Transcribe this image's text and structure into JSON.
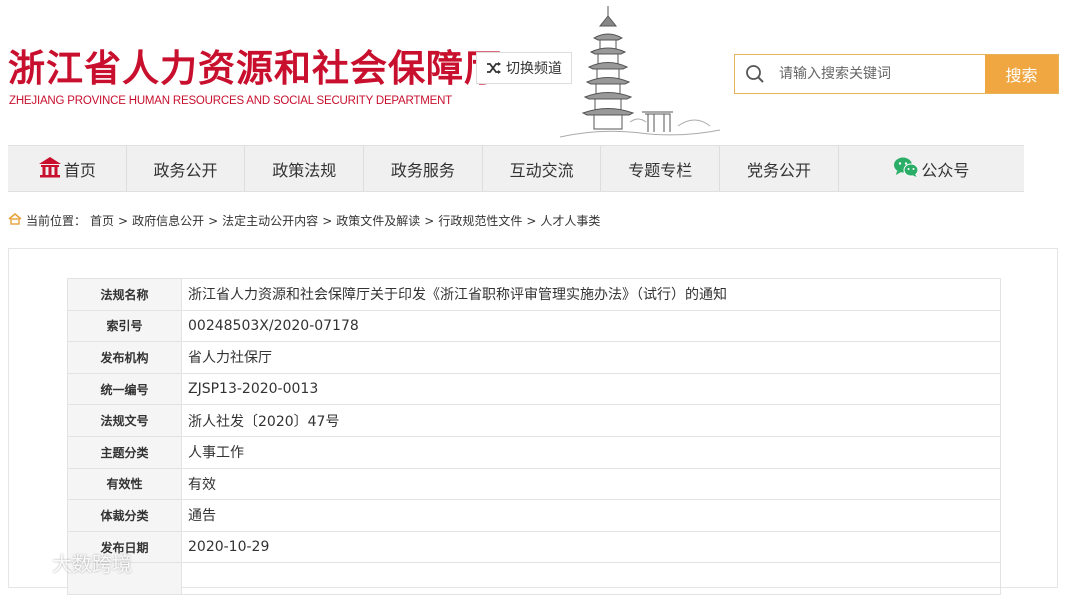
{
  "header": {
    "title": "浙江省人力资源和社会保障厅",
    "subtitle": "ZHEJIANG PROVINCE HUMAN RESOURCES AND SOCIAL SECURITY DEPARTMENT",
    "switch_channel": "切换频道",
    "brand_color": "#c8102e"
  },
  "search": {
    "placeholder": "请输入搜索关键词",
    "button": "搜索",
    "accent_color": "#f0a742"
  },
  "nav": {
    "items": [
      {
        "label": "首页",
        "icon": "home-icon"
      },
      {
        "label": "政务公开"
      },
      {
        "label": "政策法规"
      },
      {
        "label": "政务服务"
      },
      {
        "label": "互动交流"
      },
      {
        "label": "专题专栏"
      },
      {
        "label": "党务公开"
      },
      {
        "label": "公众号",
        "icon": "wechat-icon"
      }
    ]
  },
  "breadcrumb": {
    "prefix": "当前位置：",
    "items": [
      "首页",
      "政府信息公开",
      "法定主动公开内容",
      "政策文件及解读",
      "行政规范性文件",
      "人才人事类"
    ],
    "separator": ">"
  },
  "info": {
    "rows": [
      {
        "label": "法规名称",
        "value": "浙江省人力资源和社会保障厅关于印发《浙江省职称评审管理实施办法》（试行）的通知"
      },
      {
        "label": "索引号",
        "value": "00248503X/2020-07178"
      },
      {
        "label": "发布机构",
        "value": "省人力社保厅"
      },
      {
        "label": "统一编号",
        "value": "ZJSP13-2020-0013"
      },
      {
        "label": "法规文号",
        "value": "浙人社发〔2020〕47号"
      },
      {
        "label": "主题分类",
        "value": "人事工作"
      },
      {
        "label": "有效性",
        "value": "有效"
      },
      {
        "label": "体裁分类",
        "value": "通告"
      },
      {
        "label": "发布日期",
        "value": "2020-10-29"
      },
      {
        "label": "",
        "value": ""
      }
    ]
  },
  "watermark": {
    "text": "大数跨境"
  }
}
